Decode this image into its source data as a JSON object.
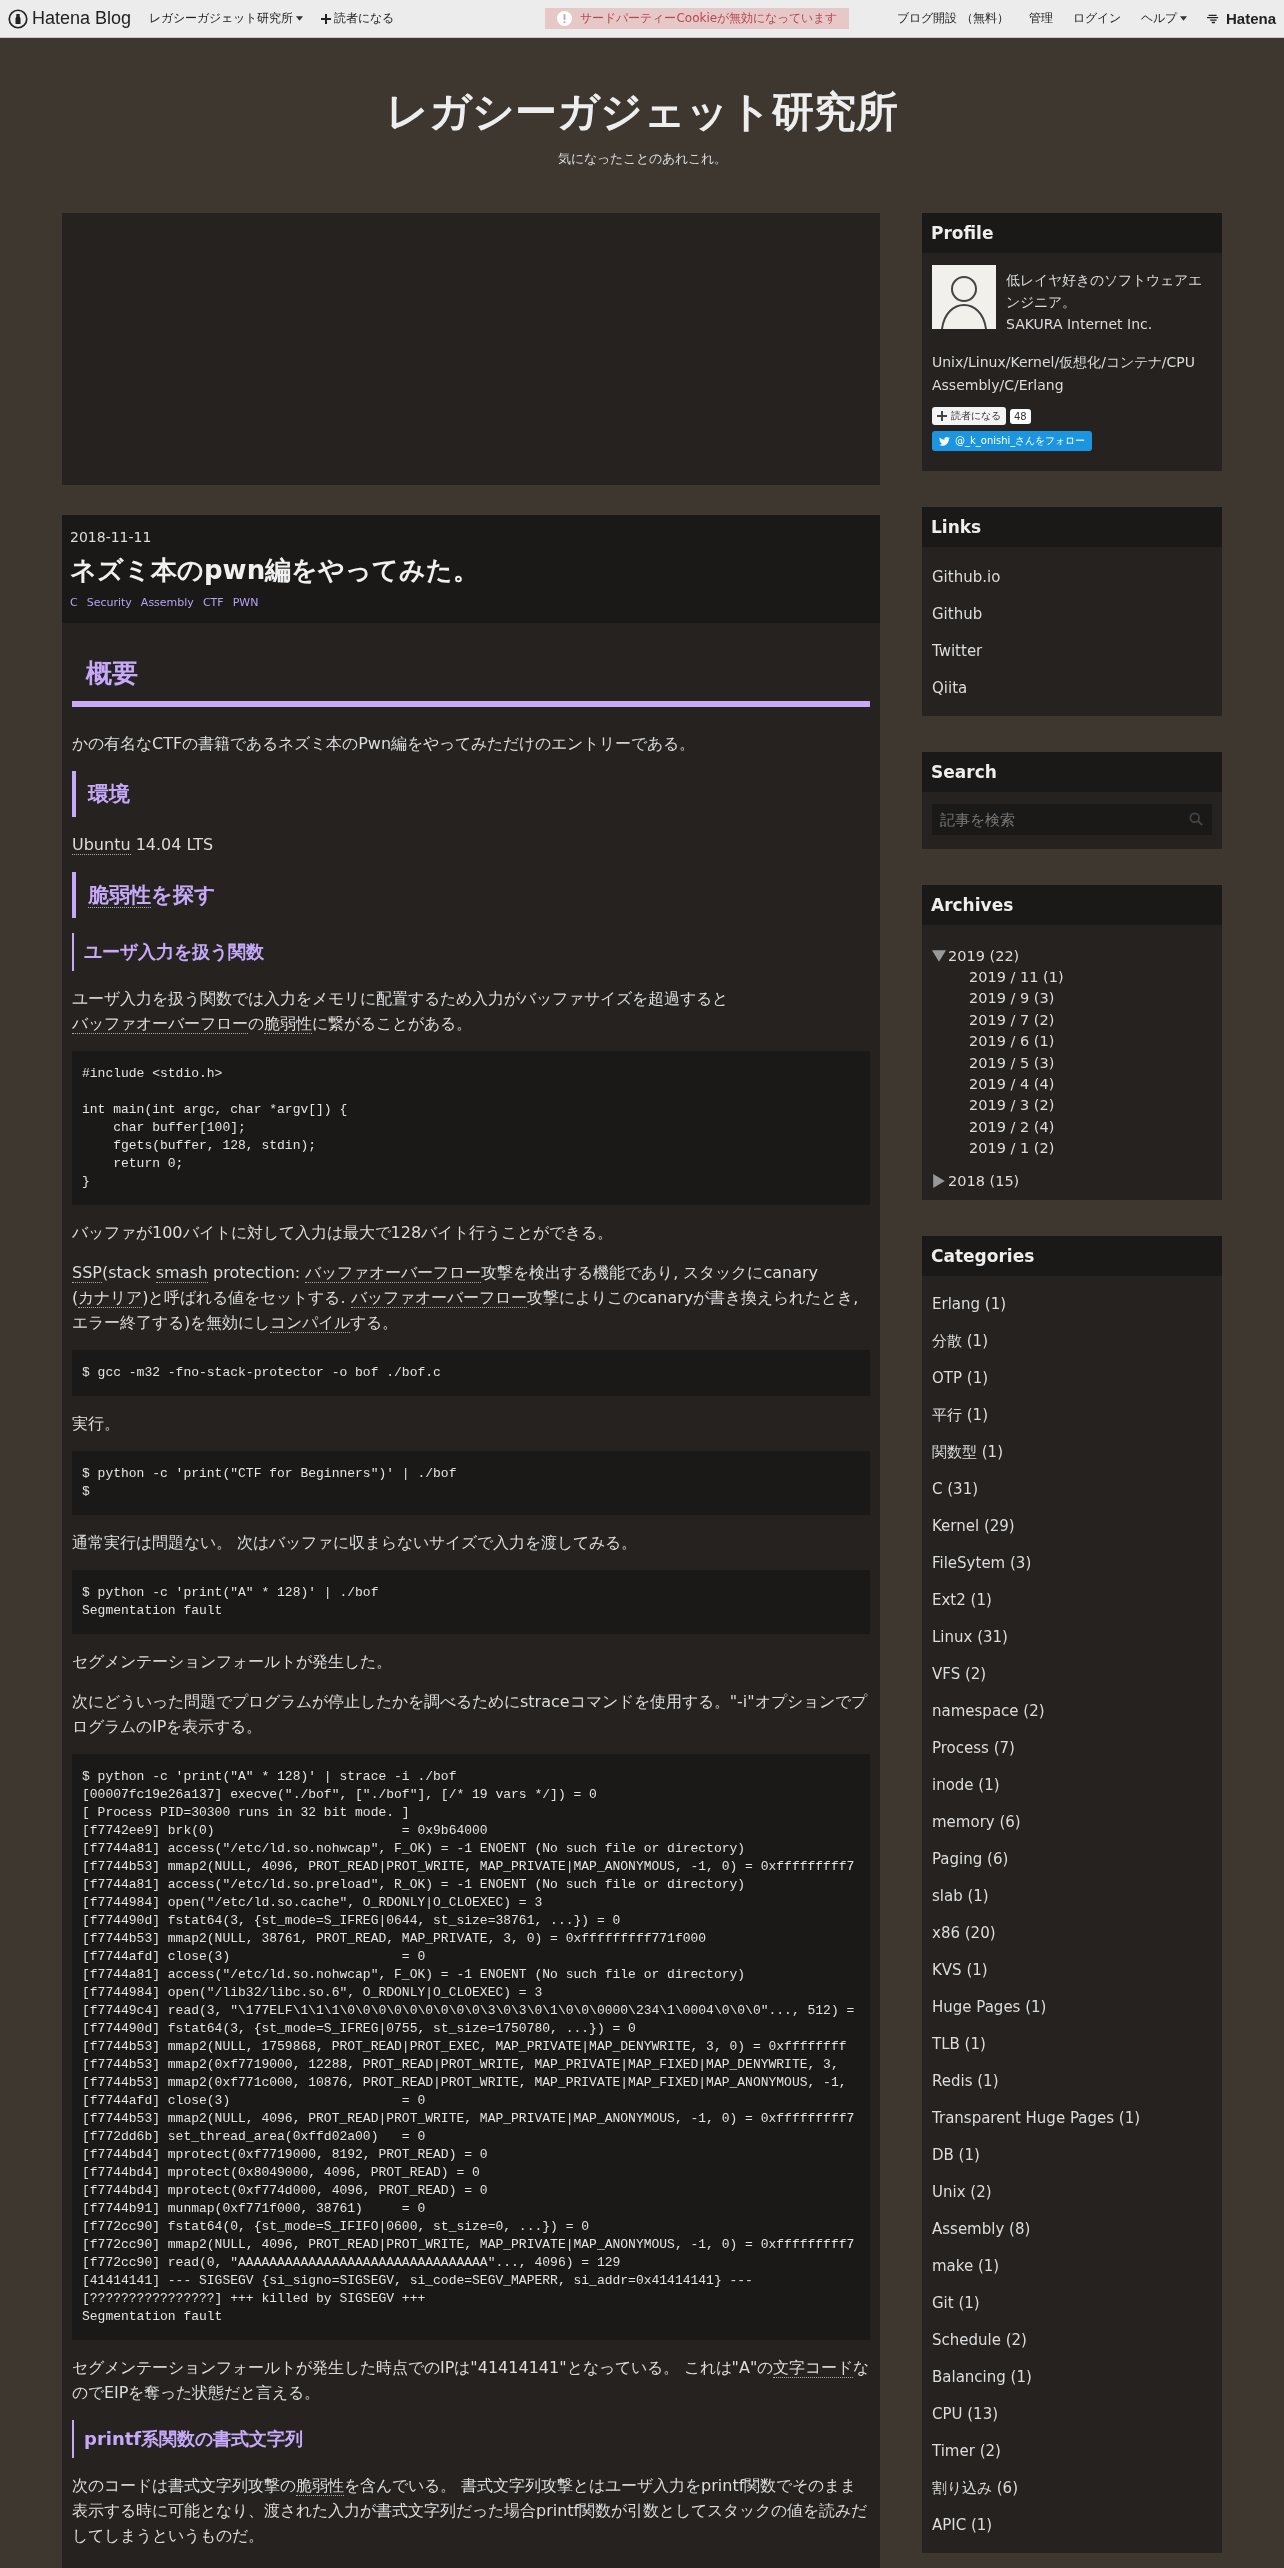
{
  "top_bar": {
    "logo": "Hatena Blog",
    "blog_menu": "レガシーガジェット研究所",
    "subscribe": "読者になる",
    "cookie_notice": "サードパーティーCookieが無効になっています",
    "links": [
      "ブログ開設 （無料）",
      "管理",
      "ログイン"
    ],
    "help": "ヘルプ",
    "brand": "Hatena"
  },
  "header": {
    "title": "レガシーガジェット研究所",
    "subtitle": "気になったことのあれこれ。"
  },
  "article": {
    "date": "2018-11-11",
    "title": "ネズミ本のpwn編をやってみた。",
    "tags": [
      "C",
      "Security",
      "Assembly",
      "CTF",
      "PWN"
    ],
    "blocks": [
      {
        "kind": "h2",
        "parts": [
          {
            "kind": "text",
            "text": "概要"
          }
        ]
      },
      {
        "kind": "p",
        "parts": [
          {
            "kind": "text",
            "text": "かの有名なCTFの書籍であるネズミ本のPwn編をやってみただけのエントリーである。"
          }
        ]
      },
      {
        "kind": "h3",
        "parts": [
          {
            "kind": "text",
            "text": "環境"
          }
        ]
      },
      {
        "kind": "p",
        "parts": [
          {
            "kind": "keyword",
            "text": "Ubuntu"
          },
          {
            "kind": "text",
            "text": " 14.04 LTS"
          }
        ]
      },
      {
        "kind": "h3",
        "parts": [
          {
            "kind": "keyword",
            "text": "脆弱性"
          },
          {
            "kind": "text",
            "text": "を探す"
          }
        ]
      },
      {
        "kind": "h4",
        "parts": [
          {
            "kind": "text",
            "text": "ユーザ入力を扱う関数"
          }
        ]
      },
      {
        "kind": "p",
        "parts": [
          {
            "kind": "text",
            "text": "ユーザ入力を扱う関数では入力をメモリに配置するため入力がバッファサイズを超過すると"
          },
          {
            "kind": "keyword",
            "text": "バッファオーバーフロー"
          },
          {
            "kind": "text",
            "text": "の"
          },
          {
            "kind": "keyword",
            "text": "脆弱性"
          },
          {
            "kind": "text",
            "text": "に繋がることがある。"
          }
        ]
      },
      {
        "kind": "code",
        "code": "#include <stdio.h>\n\nint main(int argc, char *argv[]) {\n    char buffer[100];\n    fgets(buffer, 128, stdin);\n    return 0;\n}"
      },
      {
        "kind": "p",
        "parts": [
          {
            "kind": "text",
            "text": "バッファが100バイトに対して入力は最大で128バイト行うことができる。"
          }
        ]
      },
      {
        "kind": "p",
        "parts": [
          {
            "kind": "keyword",
            "text": "SSP"
          },
          {
            "kind": "text",
            "text": "(stack "
          },
          {
            "kind": "keyword",
            "text": "smash"
          },
          {
            "kind": "text",
            "text": " protection: "
          },
          {
            "kind": "keyword",
            "text": "バッファオーバーフロー"
          },
          {
            "kind": "text",
            "text": "攻撃を検出する機能であり, スタックにcanary ("
          },
          {
            "kind": "keyword",
            "text": "カナリア"
          },
          {
            "kind": "text",
            "text": ")と呼ばれる値をセットする. "
          },
          {
            "kind": "keyword",
            "text": "バッファオーバーフロー"
          },
          {
            "kind": "text",
            "text": "攻撃によりこのcanaryが書き換えられたとき, エラー終了する)を無効にし"
          },
          {
            "kind": "keyword",
            "text": "コンパイル"
          },
          {
            "kind": "text",
            "text": "する。"
          }
        ]
      },
      {
        "kind": "code",
        "code": "$ gcc -m32 -fno-stack-protector -o bof ./bof.c"
      },
      {
        "kind": "p",
        "parts": [
          {
            "kind": "text",
            "text": "実行。"
          }
        ]
      },
      {
        "kind": "code",
        "code": "$ python -c 'print(\"CTF for Beginners\")' | ./bof\n$"
      },
      {
        "kind": "p",
        "parts": [
          {
            "kind": "text",
            "text": "通常実行は問題ない。 次はバッファに収まらないサイズで入力を渡してみる。"
          }
        ]
      },
      {
        "kind": "code",
        "code": "$ python -c 'print(\"A\" * 128)' | ./bof\nSegmentation fault"
      },
      {
        "kind": "p",
        "parts": [
          {
            "kind": "text",
            "text": "セグメンテーションフォールトが発生した。"
          }
        ]
      },
      {
        "kind": "p",
        "parts": [
          {
            "kind": "text",
            "text": "次にどういった問題でプログラムが停止したかを調べるためにstraceコマンドを使用する。\"-i\"オプションでプログラムのIPを表示する。"
          }
        ]
      },
      {
        "kind": "code",
        "code": "$ python -c 'print(\"A\" * 128)' | strace -i ./bof\n[00007fc19e26a137] execve(\"./bof\", [\"./bof\"], [/* 19 vars */]) = 0\n[ Process PID=30300 runs in 32 bit mode. ]\n[f7742ee9] brk(0)                        = 0x9b64000\n[f7744a81] access(\"/etc/ld.so.nohwcap\", F_OK) = -1 ENOENT (No such file or directory)\n[f7744b53] mmap2(NULL, 4096, PROT_READ|PROT_WRITE, MAP_PRIVATE|MAP_ANONYMOUS, -1, 0) = 0xfffffffff7\n[f7744a81] access(\"/etc/ld.so.preload\", R_OK) = -1 ENOENT (No such file or directory)\n[f7744984] open(\"/etc/ld.so.cache\", O_RDONLY|O_CLOEXEC) = 3\n[f774490d] fstat64(3, {st_mode=S_IFREG|0644, st_size=38761, ...}) = 0\n[f7744b53] mmap2(NULL, 38761, PROT_READ, MAP_PRIVATE, 3, 0) = 0xfffffffff771f000\n[f7744afd] close(3)                      = 0\n[f7744a81] access(\"/etc/ld.so.nohwcap\", F_OK) = -1 ENOENT (No such file or directory)\n[f7744984] open(\"/lib32/libc.so.6\", O_RDONLY|O_CLOEXEC) = 3\n[f77449c4] read(3, \"\\177ELF\\1\\1\\1\\0\\0\\0\\0\\0\\0\\0\\0\\0\\3\\0\\3\\0\\1\\0\\0\\0000\\234\\1\\0004\\0\\0\\0\"..., 512) =\n[f774490d] fstat64(3, {st_mode=S_IFREG|0755, st_size=1750780, ...}) = 0\n[f7744b53] mmap2(NULL, 1759868, PROT_READ|PROT_EXEC, MAP_PRIVATE|MAP_DENYWRITE, 3, 0) = 0xffffffff\n[f7744b53] mmap2(0xf7719000, 12288, PROT_READ|PROT_WRITE, MAP_PRIVATE|MAP_FIXED|MAP_DENYWRITE, 3,\n[f7744b53] mmap2(0xf771c000, 10876, PROT_READ|PROT_WRITE, MAP_PRIVATE|MAP_FIXED|MAP_ANONYMOUS, -1,\n[f7744afd] close(3)                      = 0\n[f7744b53] mmap2(NULL, 4096, PROT_READ|PROT_WRITE, MAP_PRIVATE|MAP_ANONYMOUS, -1, 0) = 0xfffffffff7\n[f772dd6b] set_thread_area(0xffd02a00)   = 0\n[f7744bd4] mprotect(0xf7719000, 8192, PROT_READ) = 0\n[f7744bd4] mprotect(0x8049000, 4096, PROT_READ) = 0\n[f7744bd4] mprotect(0xf774d000, 4096, PROT_READ) = 0\n[f7744b91] munmap(0xf771f000, 38761)     = 0\n[f772cc90] fstat64(0, {st_mode=S_IFIFO|0600, st_size=0, ...}) = 0\n[f772cc90] mmap2(NULL, 4096, PROT_READ|PROT_WRITE, MAP_PRIVATE|MAP_ANONYMOUS, -1, 0) = 0xfffffffff7\n[f772cc90] read(0, \"AAAAAAAAAAAAAAAAAAAAAAAAAAAAAAAA\"..., 4096) = 129\n[41414141] --- SIGSEGV {si_signo=SIGSEGV, si_code=SEGV_MAPERR, si_addr=0x41414141} ---\n[????????????????] +++ killed by SIGSEGV +++\nSegmentation fault"
      },
      {
        "kind": "p",
        "parts": [
          {
            "kind": "text",
            "text": "セグメンテーションフォールトが発生した時点でのIPは\"41414141\"となっている。 これは\"A\"の"
          },
          {
            "kind": "keyword",
            "text": "文字コード"
          },
          {
            "kind": "text",
            "text": "なのでEIPを奪った状態だと言える。"
          }
        ]
      },
      {
        "kind": "h4",
        "parts": [
          {
            "kind": "text",
            "text": "printf系関数の書式文字列"
          }
        ]
      },
      {
        "kind": "p",
        "parts": [
          {
            "kind": "text",
            "text": "次のコードは書式文字列攻撃の"
          },
          {
            "kind": "keyword",
            "text": "脆弱性"
          },
          {
            "kind": "text",
            "text": "を含んでいる。 書式文字列攻撃とはユーザ入力をprintf関数でそのまま表示する時に可能となり、渡された入力が書式文字列だった場合printf関数が引数としてスタックの値を読みだしてしまうというものだ。"
          }
        ]
      }
    ]
  },
  "sidebar": {
    "profile": {
      "title": "Profile",
      "description": [
        "低レイヤ好きのソフトウェアエンジニア。",
        "SAKURA Internet Inc."
      ],
      "interests": [
        "Unix/Linux/Kernel/仮想化/コンテナ/CPU",
        "Assembly/C/Erlang"
      ],
      "subscribe": "読者になる",
      "subscriber_count": "48",
      "twitter_follow": "@_k_onishi_さんをフォロー"
    },
    "links": {
      "title": "Links",
      "items": [
        "Github.io",
        "Github",
        "Twitter",
        "Qiita"
      ]
    },
    "search": {
      "title": "Search",
      "placeholder": "記事を検索"
    },
    "archives": {
      "title": "Archives",
      "years": [
        {
          "label": "2019 (22)",
          "expanded": true,
          "children": [
            "2019 / 11 (1)",
            "2019 / 9 (3)",
            "2019 / 7 (2)",
            "2019 / 6 (1)",
            "2019 / 5 (3)",
            "2019 / 4 (4)",
            "2019 / 3 (2)",
            "2019 / 2 (4)",
            "2019 / 1 (2)"
          ]
        },
        {
          "label": "2018 (15)",
          "expanded": false
        }
      ]
    },
    "categories": {
      "title": "Categories",
      "items": [
        "Erlang (1)",
        "分散 (1)",
        "OTP (1)",
        "平行 (1)",
        "関数型 (1)",
        "C (31)",
        "Kernel (29)",
        "FileSytem (3)",
        "Ext2 (1)",
        "Linux (31)",
        "VFS (2)",
        "namespace (2)",
        "Process (7)",
        "inode (1)",
        "memory (6)",
        "Paging (6)",
        "slab (1)",
        "x86 (20)",
        "KVS (1)",
        "Huge Pages (1)",
        "TLB (1)",
        "Redis (1)",
        "Transparent Huge Pages (1)",
        "DB (1)",
        "Unix (2)",
        "Assembly (8)",
        "make (1)",
        "Git (1)",
        "Schedule (2)",
        "Balancing (1)",
        "CPU (13)",
        "Timer (2)",
        "割り込み (6)",
        "APIC (1)"
      ]
    }
  }
}
